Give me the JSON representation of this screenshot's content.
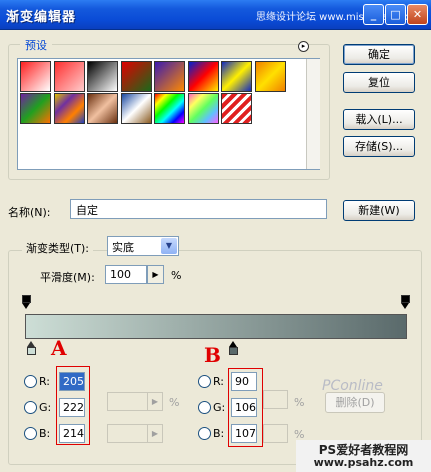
{
  "window": {
    "title": "渐变编辑器",
    "watermark": "思缘设计论坛 www.missyuan.com",
    "min_symbol": "_",
    "max_symbol": "□",
    "close_symbol": "✕"
  },
  "presets": {
    "label": "预设",
    "menu_icon": "▸",
    "swatches": [
      {
        "name": "fg-to-bg",
        "css": "linear-gradient(135deg, #ff2020, #ffffff)"
      },
      {
        "name": "fg-to-transparent",
        "css": "linear-gradient(135deg, #ff3030, #ffcccc)"
      },
      {
        "name": "black-white",
        "css": "linear-gradient(135deg, #000000, #ffffff)"
      },
      {
        "name": "red-green",
        "css": "linear-gradient(135deg, #e00000, #1a6a1a)"
      },
      {
        "name": "violet-orange",
        "css": "linear-gradient(135deg, #3a1ab0, #ff8a00)"
      },
      {
        "name": "blue-red-yellow",
        "css": "linear-gradient(135deg, #0020d0, #ff0000, #ffee00)"
      },
      {
        "name": "blue-yellow-blue",
        "css": "linear-gradient(135deg, #1028c0, #fff000, #1028c0)"
      },
      {
        "name": "orange-yellow-orange",
        "css": "linear-gradient(135deg, #f08000, #ffe000, #f08000)"
      },
      {
        "name": "violet-green-orange",
        "css": "linear-gradient(135deg, #7020a0, #20a020, #ff7000)"
      },
      {
        "name": "yellow-violet-orange-blue",
        "css": "linear-gradient(135deg, #e0c000, #7030a0, #ff8000, #2040c0)"
      },
      {
        "name": "copper",
        "css": "linear-gradient(135deg, #6a3010, #f0c0a0, #6a3010)"
      },
      {
        "name": "chrome",
        "css": "linear-gradient(135deg, #1848a0, #ffffff, #8a5a20)"
      },
      {
        "name": "spectrum",
        "css": "linear-gradient(135deg, #ff0000, #ffff00, #00ff00, #00ffff, #0000ff, #ff00ff)"
      },
      {
        "name": "transparent-rainbow",
        "css": "linear-gradient(135deg, #ff60c0, #ffff60, #60ff60, #60c0ff, #ff60ff)"
      },
      {
        "name": "transparent-stripes",
        "css": "repeating-linear-gradient(135deg, #e02020 0 4px, #ffffff 4px 7px)"
      }
    ]
  },
  "buttons": {
    "ok": "确定",
    "reset": "复位",
    "load": "载入(L)...",
    "save": "存储(S)...",
    "new": "新建(W)",
    "delete": "删除(D)"
  },
  "name": {
    "label": "名称(N):",
    "value": "自定"
  },
  "gradient_type": {
    "label": "渐变类型(T):",
    "selected": "实底",
    "smoothness_label": "平滑度(M):",
    "smoothness_value": "100",
    "smoothness_unit": "%"
  },
  "gradient": {
    "start_color": "#cdded6",
    "end_color": "#5a6a6b"
  },
  "annotations": {
    "a": "A",
    "b": "B"
  },
  "color_a": {
    "r_label": "R:",
    "r": "205",
    "g_label": "G:",
    "g": "222",
    "b_label": "B:",
    "b": "214",
    "unit": "%"
  },
  "color_b": {
    "r_label": "R:",
    "r": "90",
    "g_label": "G:",
    "g": "106",
    "b_label": "B:",
    "b": "107",
    "unit": "%"
  },
  "watermarks": {
    "ps": "PConline",
    "site_line1": "PS爱好者教程网",
    "site_line2": "www.psahz.com"
  }
}
